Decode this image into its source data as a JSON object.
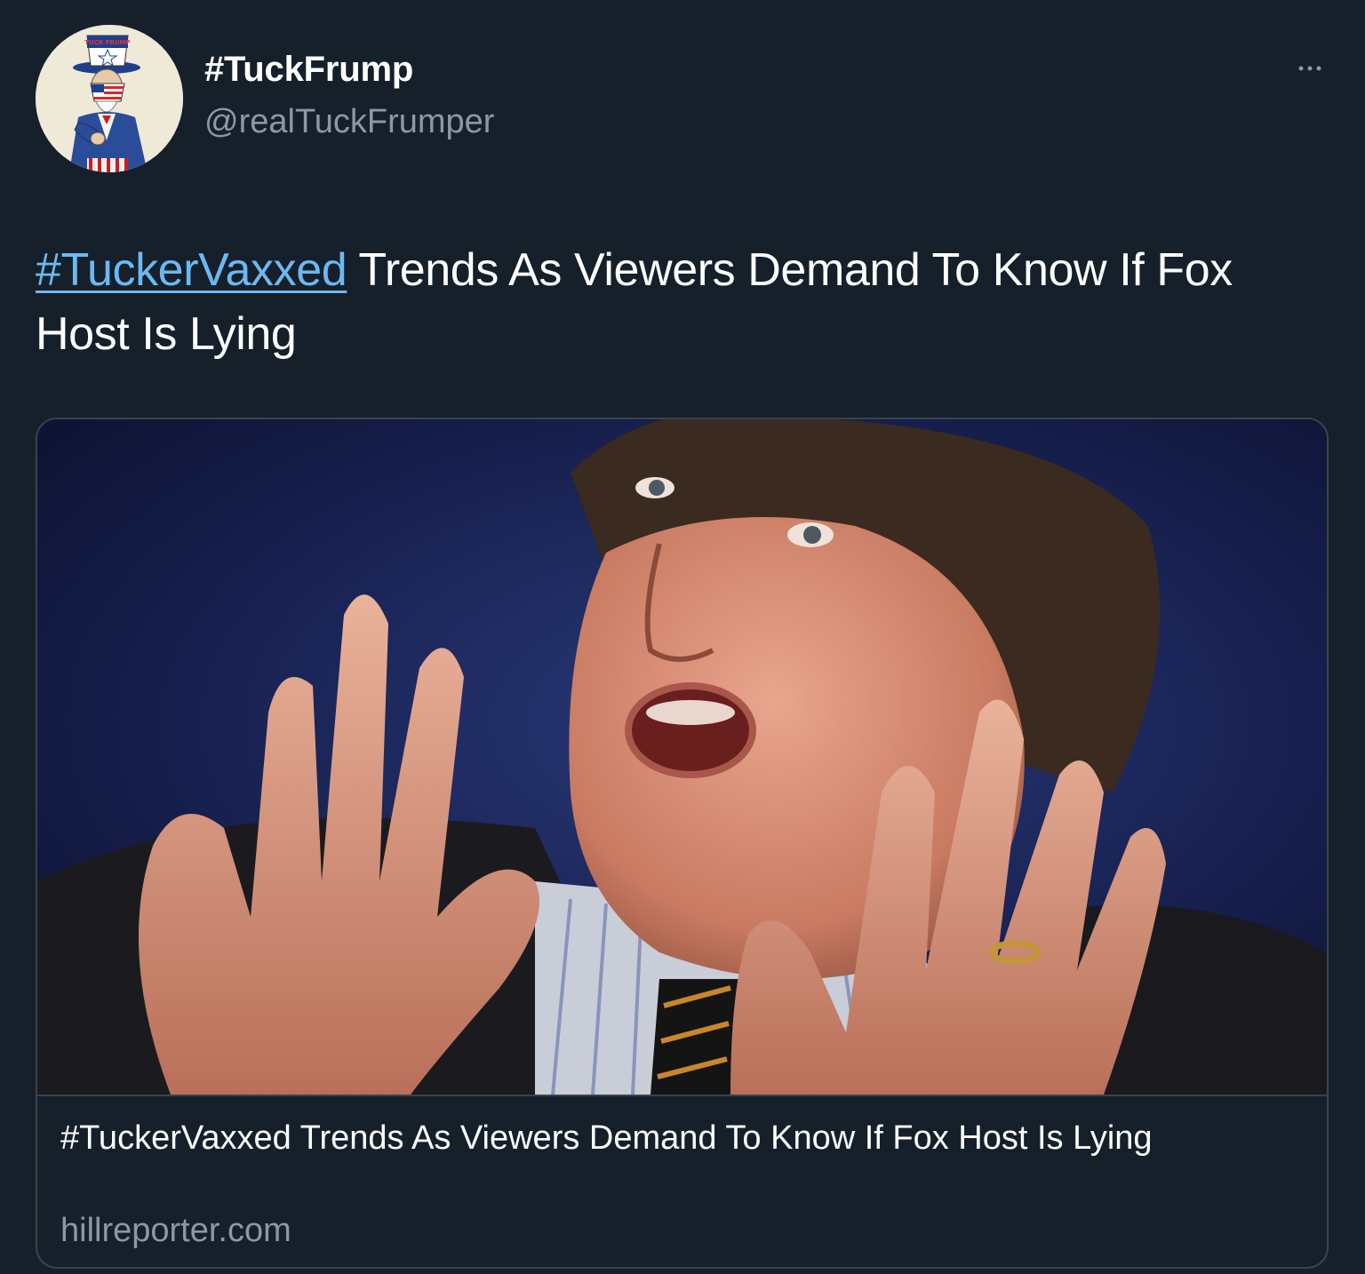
{
  "author": {
    "display_name": "#TuckFrump",
    "handle": "@realTuckFrumper",
    "avatar_text": "TUCK FRUMP"
  },
  "tweet": {
    "hashtag": "#TuckerVaxxed",
    "text": " Trends As Viewers Demand To Know If Fox Host Is Lying"
  },
  "card": {
    "title": "#TuckerVaxxed Trends As Viewers Demand To Know If Fox Host Is Lying",
    "domain": "hillreporter.com"
  },
  "icons": {
    "more": "more-horizontal-icon"
  },
  "colors": {
    "background": "#15202b",
    "link": "#6cb9f2",
    "secondary_text": "#8b98a5",
    "border": "#38444d"
  }
}
